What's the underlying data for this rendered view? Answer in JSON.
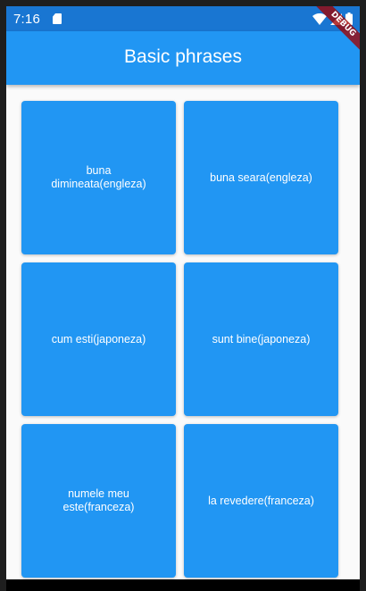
{
  "status_bar": {
    "time": "7:16",
    "icons": [
      "sd-card-icon",
      "wifi-icon",
      "signal-icon",
      "battery-icon"
    ]
  },
  "app_bar": {
    "title": "Basic phrases"
  },
  "debug_banner": {
    "label": "DEBUG"
  },
  "phrases": [
    {
      "label": "buna dimineata(engleza)"
    },
    {
      "label": "buna seara(engleza)"
    },
    {
      "label": "cum esti(japoneza)"
    },
    {
      "label": "sunt bine(japoneza)"
    },
    {
      "label": "numele meu este(franceza)"
    },
    {
      "label": "la revedere(franceza)"
    }
  ],
  "colors": {
    "primary": "#2196f3",
    "primary_dark": "#1976d2",
    "background": "#fafafa",
    "debug": "#a00000"
  }
}
